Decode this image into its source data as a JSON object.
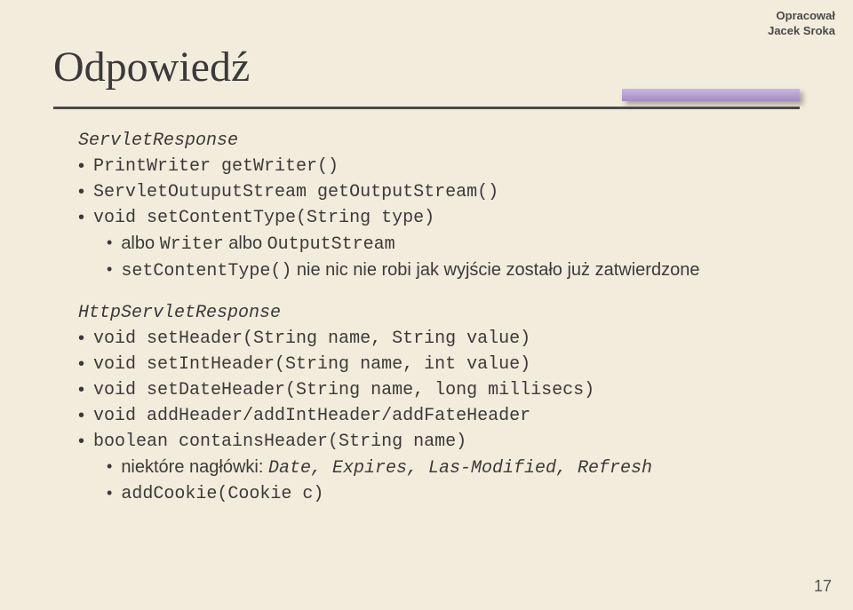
{
  "credit": {
    "line1": "Opracował",
    "line2": "Jacek Sroka"
  },
  "title": "Odpowiedź",
  "section1": {
    "heading": "ServletResponse",
    "items": [
      "PrintWriter getWriter()",
      "ServletOutuputStream getOutputStream()",
      "void setContentType(String type)"
    ],
    "sub1_prefix": "albo ",
    "sub1_code1": "Writer",
    "sub1_mid": " albo ",
    "sub1_code2": "OutputStream",
    "sub2_code": "setContentType()",
    "sub2_rest": " nie nic nie robi jak wyjście zostało już zatwierdzone"
  },
  "section2": {
    "heading": "HttpServletResponse",
    "items": [
      "void setHeader(String name, String value)",
      "void setIntHeader(String name, int value)",
      "void setDateHeader(String name, long millisecs)",
      "void addHeader/addIntHeader/addFateHeader",
      "boolean containsHeader(String name)"
    ],
    "sub1_prefix": "niektóre nagłówki: ",
    "sub1_code": "Date, Expires, Las-Modified, Refresh",
    "sub2": "addCookie(Cookie c)"
  },
  "page_number": "17"
}
